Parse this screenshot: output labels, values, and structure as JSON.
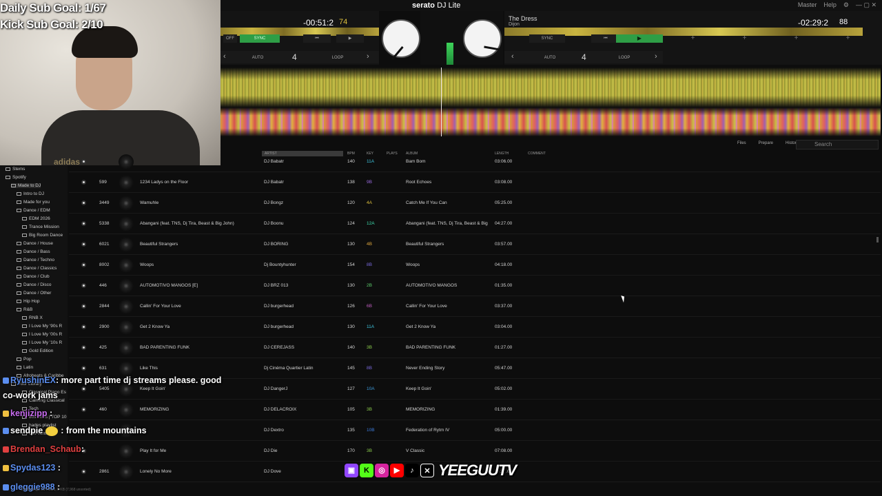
{
  "stream": {
    "daily_sub_goal": "Daily Sub Goal: 1/67",
    "kick_sub_goal": "Kick Sub Goal: 2/10",
    "webcam_shirt_text": "adidas"
  },
  "app": {
    "brand": "serato",
    "product": "DJ Lite",
    "top_right": [
      "Master",
      "Help",
      "⚙"
    ]
  },
  "deckA": {
    "time": "-00:51:2",
    "bpm": "74",
    "sync_label": "SYNC",
    "off_label": "OFF",
    "auto_label": "AUTO",
    "loop_label": "LOOP",
    "loop_value": "4"
  },
  "deckB": {
    "title": "The Dress",
    "artist": "Dijon",
    "time": "-02:29:2",
    "bpm": "88",
    "sync_label": "SYNC",
    "auto_label": "AUTO",
    "loop_label": "LOOP",
    "loop_value": "4"
  },
  "library_tools": [
    "Files",
    "Prepare",
    "History"
  ],
  "search_placeholder": "Search",
  "columns": {
    "artist": "ARTIST",
    "bpm": "BPM",
    "key": "KEY",
    "plays": "PLAYS",
    "album": "ALBUM",
    "length": "LENGTH",
    "comment": "COMMENT"
  },
  "sidebar": [
    {
      "label": "Stems",
      "indent": 0
    },
    {
      "label": "Spotify",
      "indent": 0
    },
    {
      "label": "Made to DJ",
      "indent": 1,
      "selected": true
    },
    {
      "label": "Intro to DJ",
      "indent": 2
    },
    {
      "label": "Made for you",
      "indent": 2
    },
    {
      "label": "Dance / EDM",
      "indent": 2
    },
    {
      "label": "EDM 2026",
      "indent": 3
    },
    {
      "label": "Trance Mission",
      "indent": 3
    },
    {
      "label": "Big Room Dance",
      "indent": 3
    },
    {
      "label": "Dance / House",
      "indent": 2
    },
    {
      "label": "Dance / Bass",
      "indent": 2
    },
    {
      "label": "Dance / Techno",
      "indent": 2
    },
    {
      "label": "Dance / Classics",
      "indent": 2
    },
    {
      "label": "Dance / Club",
      "indent": 2
    },
    {
      "label": "Dance / Disco",
      "indent": 2
    },
    {
      "label": "Dance / Other",
      "indent": 2
    },
    {
      "label": "Hip Hop",
      "indent": 2
    },
    {
      "label": "R&B",
      "indent": 2
    },
    {
      "label": "RNB X",
      "indent": 3
    },
    {
      "label": "I Love My '90s R",
      "indent": 3
    },
    {
      "label": "I Love My '00s R",
      "indent": 3
    },
    {
      "label": "I Love My '10s R",
      "indent": 3
    },
    {
      "label": "Gold Edition",
      "indent": 3
    },
    {
      "label": "Pop",
      "indent": 2
    },
    {
      "label": "Latin",
      "indent": 2
    },
    {
      "label": "Afrobeats & Caribbe",
      "indent": 2
    },
    {
      "label": "Your Library",
      "indent": 1
    },
    {
      "label": "Classical Piano Es",
      "indent": 3
    },
    {
      "label": "Calming Classical",
      "indent": 3
    },
    {
      "label": "Tech",
      "indent": 3
    },
    {
      "label": "80s HITS | TOP 10",
      "indent": 3
    },
    {
      "label": "hades playlist",
      "indent": 3
    },
    {
      "label": "Get Turnt",
      "indent": 3
    }
  ],
  "tracks": [
    {
      "num": "",
      "title": "",
      "artist": "DJ Babatr",
      "bpm": "140",
      "key": "11A",
      "key_color": "#3ec6e0",
      "album": "Bam Bom",
      "length": "03:06.00"
    },
    {
      "num": "599",
      "title": "1234 Ladys on the Floor",
      "artist": "DJ Babatr",
      "bpm": "138",
      "key": "9B",
      "key_color": "#9b6be0",
      "album": "Root Echoes",
      "length": "03:08.00"
    },
    {
      "num": "3449",
      "title": "Wamuhle",
      "artist": "DJ Bongz",
      "bpm": "120",
      "key": "4A",
      "key_color": "#e0c23e",
      "album": "Catch Me If You Can",
      "length": "05:25.00"
    },
    {
      "num": "5338",
      "title": "Abangani (feat. TNS, Dj Tira, Beast & Big John)",
      "artist": "DJ Boonu",
      "bpm": "124",
      "key": "12A",
      "key_color": "#3ee0b0",
      "album": "Abangani (feat. TNS, Dj Tira, Beast & Big",
      "length": "04:27.00"
    },
    {
      "num": "6021",
      "title": "Beautiful Strangers",
      "artist": "DJ BORING",
      "bpm": "130",
      "key": "4B",
      "key_color": "#e0a83e",
      "album": "Beautiful Strangers",
      "length": "03:57.00"
    },
    {
      "num": "8002",
      "title": "Woops",
      "artist": "Dj Bountyhunter",
      "bpm": "154",
      "key": "8B",
      "key_color": "#7b6be0",
      "album": "Woops",
      "length": "04:18.00"
    },
    {
      "num": "446",
      "title": "AUTOMOTIVO MANGOS [E]",
      "artist": "DJ BRZ 013",
      "bpm": "130",
      "key": "2B",
      "key_color": "#5ed06e",
      "album": "AUTOMOTIVO MANGOS",
      "length": "01:35.00"
    },
    {
      "num": "2844",
      "title": "Callin' For Your Love",
      "artist": "DJ burgerhead",
      "bpm": "126",
      "key": "6B",
      "key_color": "#c05ec0",
      "album": "Callin' For Your Love",
      "length": "03:37.00"
    },
    {
      "num": "2900",
      "title": "Get 2 Know Ya",
      "artist": "DJ burgerhead",
      "bpm": "130",
      "key": "11A",
      "key_color": "#3ec6e0",
      "album": "Get 2 Know Ya",
      "length": "03:04.00"
    },
    {
      "num": "425",
      "title": "BAD PARENTING FUNK",
      "artist": "DJ CEREJASS",
      "bpm": "140",
      "key": "3B",
      "key_color": "#8ed04e",
      "album": "BAD PARENTING FUNK",
      "length": "01:27.00"
    },
    {
      "num": "631",
      "title": "Like This",
      "artist": "Dj Cinéma Quartier Latin",
      "bpm": "145",
      "key": "8B",
      "key_color": "#7b6be0",
      "album": "Never Ending Story",
      "length": "05:47.00"
    },
    {
      "num": "5405",
      "title": "Keep It Goin'",
      "artist": "DJ DangerJ",
      "bpm": "127",
      "key": "10A",
      "key_color": "#3e9ee0",
      "album": "Keep It Goin'",
      "length": "05:02.00"
    },
    {
      "num": "460",
      "title": "MEMORIZING",
      "artist": "DJ DELACROIX",
      "bpm": "105",
      "key": "3B",
      "key_color": "#8ed04e",
      "album": "MEMORIZING",
      "length": "01:39.00"
    },
    {
      "num": "",
      "title": "",
      "artist": "DJ Dextro",
      "bpm": "135",
      "key": "10B",
      "key_color": "#3e7ee0",
      "album": "Federation of Rytm IV",
      "length": "05:00.00"
    },
    {
      "num": "",
      "title": "Play It for Me",
      "artist": "DJ Die",
      "bpm": "170",
      "key": "3B",
      "key_color": "#8ed04e",
      "album": "V Classic",
      "length": "07:08.00"
    },
    {
      "num": "2861",
      "title": "Lonely No More",
      "artist": "DJ Dove",
      "bpm": "",
      "key": "",
      "key_color": "#888888",
      "album": "",
      "length": "03:07.00"
    }
  ],
  "chat": [
    {
      "user": "RyushinEX",
      "user_color": "#5b8ef0",
      "message": ": more part time dj streams please. good"
    },
    {
      "user": "",
      "user_color": "#ffffff",
      "message": "co-work jams"
    },
    {
      "user": "kenjizipp",
      "user_color": "#c86cf0",
      "message": " :"
    },
    {
      "user": "sendpie",
      "user_color": "#ffffff",
      "message": ": from the mountains"
    },
    {
      "user": "Brendan_Schaub",
      "user_color": "#e04040",
      "message": ":"
    },
    {
      "user": "Spydas123",
      "user_color": "#5b8ef0",
      "message": " :"
    },
    {
      "user": "gleggie988",
      "user_color": "#5b8ef0",
      "message": " :"
    }
  ],
  "social_handle": "YEEGUUTV",
  "footer": "3,409 songs, 20 Hours, 0 KB (7,968 unsorted)"
}
